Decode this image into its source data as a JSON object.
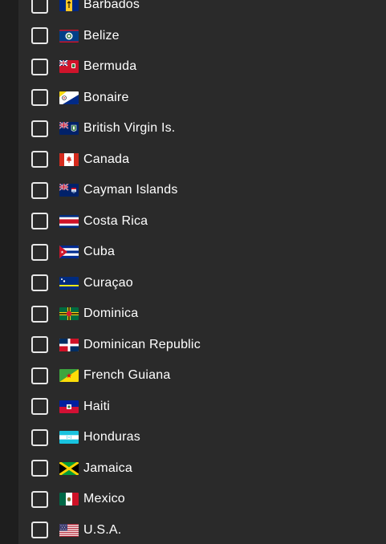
{
  "countries": [
    {
      "label": "Barbados",
      "flag": "barbados-flag"
    },
    {
      "label": "Belize",
      "flag": "belize-flag"
    },
    {
      "label": "Bermuda",
      "flag": "bermuda-flag"
    },
    {
      "label": "Bonaire",
      "flag": "bonaire-flag"
    },
    {
      "label": "British Virgin Is.",
      "flag": "british-virgin-islands-flag"
    },
    {
      "label": "Canada",
      "flag": "canada-flag"
    },
    {
      "label": "Cayman Islands",
      "flag": "cayman-islands-flag"
    },
    {
      "label": "Costa Rica",
      "flag": "costa-rica-flag"
    },
    {
      "label": "Cuba",
      "flag": "cuba-flag"
    },
    {
      "label": "Curaçao",
      "flag": "curacao-flag"
    },
    {
      "label": "Dominica",
      "flag": "dominica-flag"
    },
    {
      "label": "Dominican Republic",
      "flag": "dominican-republic-flag"
    },
    {
      "label": "French Guiana",
      "flag": "french-guiana-flag"
    },
    {
      "label": "Haiti",
      "flag": "haiti-flag"
    },
    {
      "label": "Honduras",
      "flag": "honduras-flag"
    },
    {
      "label": "Jamaica",
      "flag": "jamaica-flag"
    },
    {
      "label": "Mexico",
      "flag": "mexico-flag"
    },
    {
      "label": "U.S.A.",
      "flag": "usa-flag"
    }
  ],
  "colors": {
    "background": "#1e1e1e",
    "panel": "#2a2a2a",
    "checkbox_border": "#e8e8e8",
    "text": "#ffffff"
  }
}
